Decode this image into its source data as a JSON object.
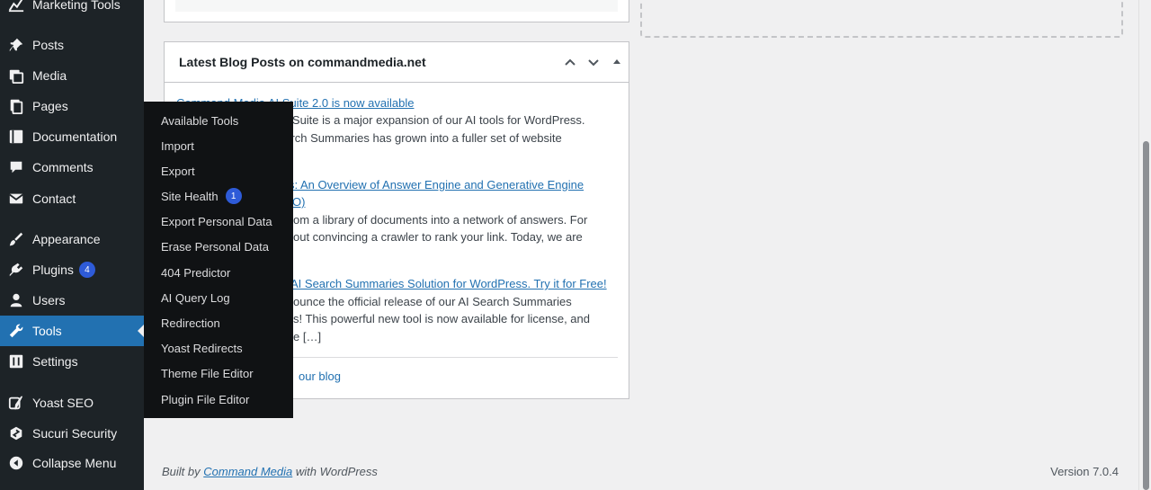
{
  "sidebar": {
    "items": [
      {
        "label": "Marketing Tools",
        "icon": "chart-icon"
      },
      {
        "label": "Posts",
        "icon": "pushpin-icon"
      },
      {
        "label": "Media",
        "icon": "media-icon"
      },
      {
        "label": "Pages",
        "icon": "pages-icon"
      },
      {
        "label": "Documentation",
        "icon": "book-icon"
      },
      {
        "label": "Comments",
        "icon": "comment-icon"
      },
      {
        "label": "Contact",
        "icon": "mail-icon"
      },
      {
        "label": "Appearance",
        "icon": "brush-icon"
      },
      {
        "label": "Plugins",
        "icon": "plug-icon",
        "badge": "4"
      },
      {
        "label": "Users",
        "icon": "user-icon"
      },
      {
        "label": "Tools",
        "icon": "wrench-icon",
        "active": true
      },
      {
        "label": "Settings",
        "icon": "sliders-icon"
      },
      {
        "label": "Yoast SEO",
        "icon": "yoast-icon"
      },
      {
        "label": "Sucuri Security",
        "icon": "sucuri-icon"
      },
      {
        "label": "Collapse Menu",
        "icon": "collapse-icon"
      }
    ]
  },
  "tools_flyout": {
    "items": [
      {
        "label": "Available Tools"
      },
      {
        "label": "Import"
      },
      {
        "label": "Export"
      },
      {
        "label": "Site Health",
        "badge": "1"
      },
      {
        "label": "Export Personal Data"
      },
      {
        "label": "Erase Personal Data"
      },
      {
        "label": "404 Predictor"
      },
      {
        "label": "AI Query Log"
      },
      {
        "label": "Redirection"
      },
      {
        "label": "Yoast Redirects"
      },
      {
        "label": "Theme File Editor"
      },
      {
        "label": "Plugin File Editor"
      }
    ]
  },
  "blog_widget": {
    "title": "Latest Blog Posts on commandmedia.net",
    "posts": [
      {
        "link": "Command Media AI Suite 2.0 is now available",
        "excerpt_line1": "AI Suite is a major expansion of our AI tools for WordPress.",
        "excerpt_line2": "earch Summaries has grown into a fuller set of website"
      },
      {
        "link_line1": "s: An Overview of Answer Engine and Generative Engine",
        "link_line2": "O)",
        "excerpt_line1": "om a library of documents into a network of answers. For",
        "excerpt_line2": "out convincing a crawler to rank your link. Today, we are"
      },
      {
        "link": "AI Search Summaries Solution for WordPress. Try it for Free!",
        "excerpt_line1": "ounce the official release of our AI Search Summaries",
        "excerpt_line2": "s! This powerful new tool is now available for license, and",
        "excerpt_line3": "e […]"
      }
    ],
    "more_link": "our blog"
  },
  "footer": {
    "built_by_prefix": "Built by ",
    "built_by_link": "Command Media",
    "built_by_suffix": " with WordPress",
    "version": "Version 7.0.4"
  },
  "colors": {
    "sidebar_bg": "#1d2327",
    "active_bg": "#2271b1",
    "badge_bg": "#2e5bd8",
    "link": "#2271b1"
  }
}
